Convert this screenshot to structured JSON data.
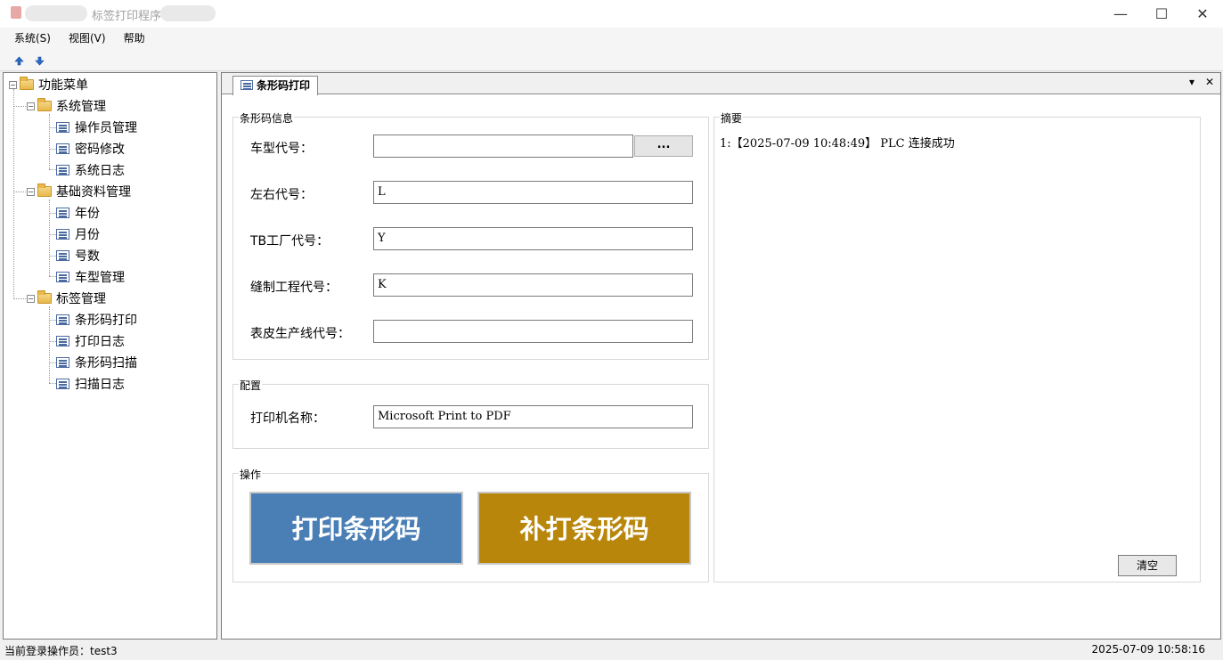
{
  "window": {
    "title": "标签打印程序",
    "minimize_glyph": "—",
    "maximize_glyph": "☐",
    "close_glyph": "✕"
  },
  "menu": [
    "系统(S)",
    "视图(V)",
    "帮助"
  ],
  "toolbar": {
    "up_icon": "arrow-up-icon",
    "down_icon": "arrow-down-icon"
  },
  "tree": {
    "root": "功能菜单",
    "groups": [
      {
        "label": "系统管理",
        "items": [
          "操作员管理",
          "密码修改",
          "系统日志"
        ]
      },
      {
        "label": "基础资料管理",
        "items": [
          "年份",
          "月份",
          "号数",
          "车型管理"
        ]
      },
      {
        "label": "标签管理",
        "items": [
          "条形码打印",
          "打印日志",
          "条形码扫描",
          "扫描日志"
        ]
      }
    ]
  },
  "tab": {
    "label": "条形码打印",
    "dropdown_glyph": "▾",
    "close_glyph": "✕"
  },
  "barcode_info": {
    "title": "条形码信息",
    "fields": [
      {
        "label": "车型代号：",
        "value": ""
      },
      {
        "label": "左右代号：",
        "value": "L"
      },
      {
        "label": "TB工厂代号：",
        "value": "Y"
      },
      {
        "label": "缝制工程代号：",
        "value": "K"
      },
      {
        "label": "表皮生产线代号：",
        "value": ""
      }
    ],
    "browse_label": "..."
  },
  "config": {
    "title": "配置",
    "printer_label": "打印机名称：",
    "printer_value": "Microsoft Print to PDF"
  },
  "actions": {
    "title": "操作",
    "print_label": "打印条形码",
    "reprint_label": "补打条形码",
    "print_color": "#4a7fb5",
    "reprint_color": "#b8860b"
  },
  "summary": {
    "title": "摘要",
    "log": "1:【2025-07-09 10:48:49】 PLC 连接成功",
    "clear_label": "清空"
  },
  "status": {
    "operator": "当前登录操作员：test3",
    "datetime": "2025-07-09 10:58:16"
  }
}
